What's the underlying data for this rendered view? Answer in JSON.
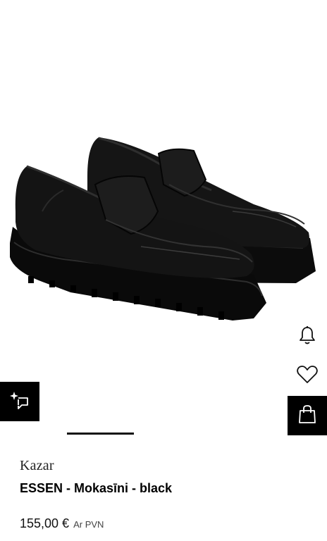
{
  "product": {
    "image_alt": "Kazar ESSEN black leather loafers",
    "brand": "Kazar",
    "name": "ESSEN - Mokasīni - black",
    "price": "155,00 €",
    "vat_note": "Ar PVN"
  },
  "actions": {
    "notify_icon": "bell-icon",
    "wishlist_icon": "heart-icon",
    "cart_icon": "shopping-bag-icon",
    "try_on_icon": "sparkle-try-on-icon"
  },
  "colors": {
    "accent": "#000000",
    "background": "#ffffff"
  },
  "gallery": {
    "active_index": 1
  }
}
